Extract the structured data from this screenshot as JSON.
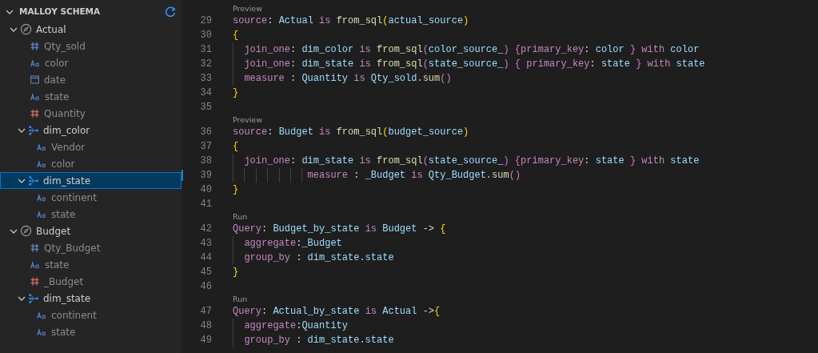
{
  "sidebar": {
    "title": "MALLOY SCHEMA",
    "expanded": true,
    "tree": [
      {
        "label": "Actual",
        "kind": "source",
        "expanded": true,
        "selected": false,
        "children": [
          {
            "label": "Qty_sold",
            "kind": "number",
            "selected": false
          },
          {
            "label": "color",
            "kind": "string",
            "selected": false
          },
          {
            "label": "date",
            "kind": "date",
            "selected": false
          },
          {
            "label": "state",
            "kind": "string",
            "selected": false
          },
          {
            "label": "Quantity",
            "kind": "measure",
            "selected": false
          },
          {
            "label": "dim_color",
            "kind": "join",
            "expanded": true,
            "selected": false,
            "children": [
              {
                "label": "Vendor",
                "kind": "string",
                "selected": false
              },
              {
                "label": "color",
                "kind": "string",
                "selected": false
              }
            ]
          },
          {
            "label": "dim_state",
            "kind": "join",
            "expanded": true,
            "selected": true,
            "children": [
              {
                "label": "continent",
                "kind": "string",
                "selected": false
              },
              {
                "label": "state",
                "kind": "string",
                "selected": false
              }
            ]
          }
        ]
      },
      {
        "label": "Budget",
        "kind": "source",
        "expanded": true,
        "selected": false,
        "children": [
          {
            "label": "Qty_Budget",
            "kind": "number",
            "selected": false
          },
          {
            "label": "state",
            "kind": "string",
            "selected": false
          },
          {
            "label": "_Budget",
            "kind": "measure",
            "selected": false
          },
          {
            "label": "dim_state",
            "kind": "join",
            "expanded": true,
            "selected": false,
            "children": [
              {
                "label": "continent",
                "kind": "string",
                "selected": false
              },
              {
                "label": "state",
                "kind": "string",
                "selected": false
              }
            ]
          }
        ]
      }
    ]
  },
  "editor": {
    "lines": [
      {
        "kind": "lens",
        "text": "Preview"
      },
      {
        "kind": "code",
        "number": "29",
        "modified": false,
        "tokens": [
          {
            "kind": "kw",
            "text": "source"
          },
          {
            "kind": "punct",
            "text": ": "
          },
          {
            "kind": "id",
            "text": "Actual "
          },
          {
            "kind": "kw",
            "text": "is "
          },
          {
            "kind": "fn",
            "text": "from_sql"
          },
          {
            "kind": "b1",
            "text": "("
          },
          {
            "kind": "id",
            "text": "actual_source"
          },
          {
            "kind": "b1",
            "text": ")"
          }
        ]
      },
      {
        "kind": "code",
        "number": "30",
        "modified": false,
        "tokens": [
          {
            "kind": "b1",
            "text": "{"
          }
        ]
      },
      {
        "kind": "code",
        "number": "31",
        "modified": false,
        "tokens": [
          {
            "kind": "kw",
            "text": "  join_one"
          },
          {
            "kind": "punct",
            "text": ": "
          },
          {
            "kind": "id",
            "text": "dim_color "
          },
          {
            "kind": "kw",
            "text": "is "
          },
          {
            "kind": "fn",
            "text": "from_sql"
          },
          {
            "kind": "b2",
            "text": "("
          },
          {
            "kind": "id",
            "text": "color_source_"
          },
          {
            "kind": "b2",
            "text": ") {"
          },
          {
            "kind": "kw",
            "text": "primary_key"
          },
          {
            "kind": "punct",
            "text": ": "
          },
          {
            "kind": "id",
            "text": "color "
          },
          {
            "kind": "b2",
            "text": "} "
          },
          {
            "kind": "kw",
            "text": "with "
          },
          {
            "kind": "id",
            "text": "color"
          }
        ]
      },
      {
        "kind": "code",
        "number": "32",
        "modified": false,
        "tokens": [
          {
            "kind": "kw",
            "text": "  join_one"
          },
          {
            "kind": "punct",
            "text": ": "
          },
          {
            "kind": "id",
            "text": "dim_state "
          },
          {
            "kind": "kw",
            "text": "is "
          },
          {
            "kind": "fn",
            "text": "from_sql"
          },
          {
            "kind": "b2",
            "text": "("
          },
          {
            "kind": "id",
            "text": "state_source_"
          },
          {
            "kind": "b2",
            "text": ") { "
          },
          {
            "kind": "kw",
            "text": "primary_key"
          },
          {
            "kind": "punct",
            "text": ": "
          },
          {
            "kind": "id",
            "text": "state "
          },
          {
            "kind": "b2",
            "text": "} "
          },
          {
            "kind": "kw",
            "text": "with "
          },
          {
            "kind": "id",
            "text": "state"
          }
        ]
      },
      {
        "kind": "code",
        "number": "33",
        "modified": false,
        "tokens": [
          {
            "kind": "kw",
            "text": "  measure"
          },
          {
            "kind": "punct",
            "text": " : "
          },
          {
            "kind": "id",
            "text": "Quantity "
          },
          {
            "kind": "kw",
            "text": "is "
          },
          {
            "kind": "id",
            "text": "Qty_sold."
          },
          {
            "kind": "fn",
            "text": "sum"
          },
          {
            "kind": "b2",
            "text": "()"
          }
        ]
      },
      {
        "kind": "code",
        "number": "34",
        "modified": false,
        "tokens": [
          {
            "kind": "b1",
            "text": "}"
          }
        ]
      },
      {
        "kind": "code",
        "number": "35",
        "modified": false
      },
      {
        "kind": "lens",
        "text": "Preview"
      },
      {
        "kind": "code",
        "number": "36",
        "modified": false,
        "tokens": [
          {
            "kind": "kw",
            "text": "source"
          },
          {
            "kind": "punct",
            "text": ": "
          },
          {
            "kind": "id",
            "text": "Budget "
          },
          {
            "kind": "kw",
            "text": "is "
          },
          {
            "kind": "fn",
            "text": "from_sql"
          },
          {
            "kind": "b1",
            "text": "("
          },
          {
            "kind": "id",
            "text": "budget_source"
          },
          {
            "kind": "b1",
            "text": ")"
          }
        ]
      },
      {
        "kind": "code",
        "number": "37",
        "modified": false,
        "tokens": [
          {
            "kind": "b1",
            "text": "{"
          }
        ]
      },
      {
        "kind": "code",
        "number": "38",
        "modified": false,
        "tokens": [
          {
            "kind": "kw",
            "text": "  join_one"
          },
          {
            "kind": "punct",
            "text": ": "
          },
          {
            "kind": "id",
            "text": "dim_state "
          },
          {
            "kind": "kw",
            "text": "is "
          },
          {
            "kind": "fn",
            "text": "from_sql"
          },
          {
            "kind": "b2",
            "text": "("
          },
          {
            "kind": "id",
            "text": "state_source_"
          },
          {
            "kind": "b2",
            "text": ") {"
          },
          {
            "kind": "kw",
            "text": "primary_key"
          },
          {
            "kind": "punct",
            "text": ": "
          },
          {
            "kind": "id",
            "text": "state "
          },
          {
            "kind": "b2",
            "text": "} "
          },
          {
            "kind": "kw",
            "text": "with "
          },
          {
            "kind": "id",
            "text": "state"
          }
        ]
      },
      {
        "kind": "code",
        "number": "39",
        "modified": true,
        "tokens": [
          {
            "kind": "kw",
            "text": "             measure"
          },
          {
            "kind": "punct",
            "text": " : "
          },
          {
            "kind": "id",
            "text": "_Budget "
          },
          {
            "kind": "kw",
            "text": "is "
          },
          {
            "kind": "id",
            "text": "Qty_Budget."
          },
          {
            "kind": "fn",
            "text": "sum"
          },
          {
            "kind": "b2",
            "text": "()"
          }
        ]
      },
      {
        "kind": "code",
        "number": "40",
        "modified": false,
        "tokens": [
          {
            "kind": "b1",
            "text": "}"
          }
        ]
      },
      {
        "kind": "code",
        "number": "41",
        "modified": false
      },
      {
        "kind": "lens",
        "text": "Run"
      },
      {
        "kind": "code",
        "number": "42",
        "modified": false,
        "tokens": [
          {
            "kind": "kw",
            "text": "Query"
          },
          {
            "kind": "punct",
            "text": ": "
          },
          {
            "kind": "id",
            "text": "Budget_by_state "
          },
          {
            "kind": "kw",
            "text": "is "
          },
          {
            "kind": "id",
            "text": "Budget "
          },
          {
            "kind": "punct",
            "text": "-> "
          },
          {
            "kind": "b1",
            "text": "{"
          }
        ]
      },
      {
        "kind": "code",
        "number": "43",
        "modified": false,
        "tokens": [
          {
            "kind": "kw",
            "text": "  aggregate"
          },
          {
            "kind": "punct",
            "text": ":"
          },
          {
            "kind": "id",
            "text": "_Budget"
          }
        ]
      },
      {
        "kind": "code",
        "number": "44",
        "modified": false,
        "tokens": [
          {
            "kind": "kw",
            "text": "  group_by"
          },
          {
            "kind": "punct",
            "text": " : "
          },
          {
            "kind": "id",
            "text": "dim_state.state"
          }
        ]
      },
      {
        "kind": "code",
        "number": "45",
        "modified": false,
        "tokens": [
          {
            "kind": "b1",
            "text": "}"
          }
        ]
      },
      {
        "kind": "code",
        "number": "46",
        "modified": false
      },
      {
        "kind": "lens",
        "text": "Run"
      },
      {
        "kind": "code",
        "number": "47",
        "modified": false,
        "tokens": [
          {
            "kind": "kw",
            "text": "Query"
          },
          {
            "kind": "punct",
            "text": ": "
          },
          {
            "kind": "id",
            "text": "Actual_by_state "
          },
          {
            "kind": "kw",
            "text": "is "
          },
          {
            "kind": "id",
            "text": "Actual "
          },
          {
            "kind": "punct",
            "text": "->"
          },
          {
            "kind": "b1",
            "text": "{"
          }
        ]
      },
      {
        "kind": "code",
        "number": "48",
        "modified": false,
        "tokens": [
          {
            "kind": "kw",
            "text": "  aggregate"
          },
          {
            "kind": "punct",
            "text": ":"
          },
          {
            "kind": "id",
            "text": "Quantity"
          }
        ]
      },
      {
        "kind": "code",
        "number": "49",
        "modified": false,
        "tokens": [
          {
            "kind": "kw",
            "text": "  group_by"
          },
          {
            "kind": "punct",
            "text": " : "
          },
          {
            "kind": "id",
            "text": "dim_state.state"
          }
        ]
      }
    ]
  }
}
